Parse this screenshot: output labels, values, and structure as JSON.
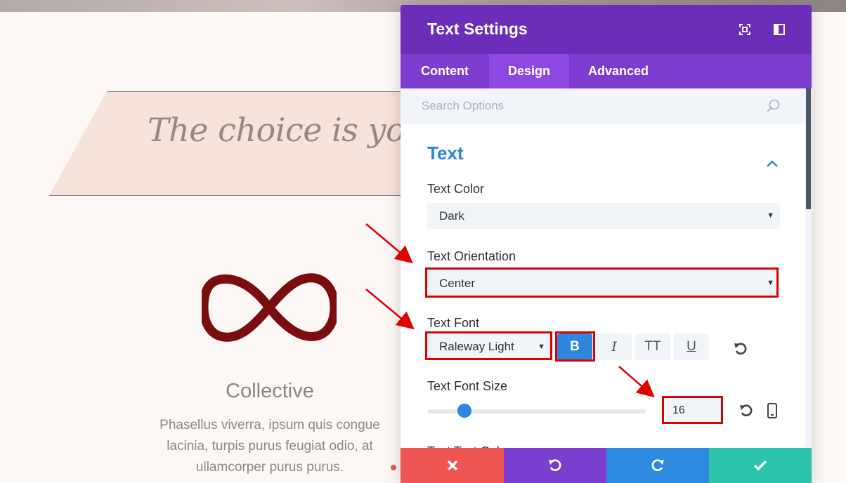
{
  "page": {
    "banner_text": "The choice is yours",
    "feature_title": "Collective",
    "feature_body": "Phasellus viverra, ipsum quis congue lacinia, turpis purus feugiat odio, at ullamcorper purus purus."
  },
  "panel": {
    "title": "Text Settings",
    "header_icons": [
      "fullscreen-icon",
      "split-view-icon"
    ],
    "tabs": [
      {
        "label": "Content",
        "active": false
      },
      {
        "label": "Design",
        "active": true
      },
      {
        "label": "Advanced",
        "active": false
      }
    ],
    "search": {
      "placeholder": "Search Options"
    },
    "section": {
      "title": "Text",
      "expanded": true
    },
    "text_color": {
      "label": "Text Color",
      "value": "Dark"
    },
    "text_orientation": {
      "label": "Text Orientation",
      "value": "Center"
    },
    "text_font": {
      "label": "Text Font",
      "value": "Raleway Light",
      "buttons": {
        "bold": "B",
        "italic": "I",
        "uppercase": "TT",
        "underline": "U"
      },
      "bold_active": true
    },
    "text_font_size": {
      "label": "Text Font Size",
      "value": "16",
      "slider_fraction": 0.17
    },
    "next_label_partial": "Text Text Color",
    "footer": {
      "buttons": [
        "close-icon",
        "undo-icon",
        "redo-icon",
        "save-icon"
      ],
      "colors": [
        "#ef5555",
        "#7b3fd0",
        "#2e8ade",
        "#29c4a9"
      ]
    }
  },
  "colors": {
    "header": "#6c2eb9",
    "tabs": "#7e3bd0",
    "active_tab": "#8f47e2",
    "accent": "#2e86de",
    "highlight": "#e00000",
    "infinity": "#7a0d0d"
  }
}
